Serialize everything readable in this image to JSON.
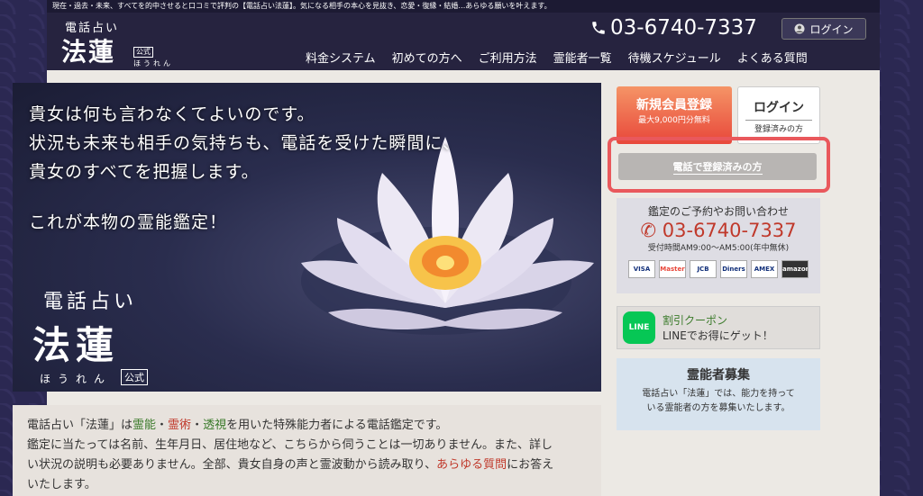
{
  "topbar": {
    "text": "現在・過去・未来、すべてを的中させると口コミで評判の【電話占い法蓮】。気になる相手の本心を見抜き、恋愛・復縁・結婚…あらゆる願いを叶えます。"
  },
  "header": {
    "logo_small": "電話占い",
    "logo_big": "法蓮",
    "logo_badge": "公式",
    "logo_kana": "ほうれん",
    "phone": "03-6740-7337",
    "login": "ログイン"
  },
  "nav": {
    "items": [
      "料金システム",
      "初めての方へ",
      "ご利用方法",
      "霊能者一覧",
      "待機スケジュール",
      "よくある質問"
    ]
  },
  "hero": {
    "line1": "貴女は何も言わなくてよいのです。",
    "line2": "状況も未来も相手の気持ちも、電話を受けた瞬間に、",
    "line3": "貴女のすべてを把握します。",
    "line4": "これが本物の霊能鑑定！",
    "brand_small": "電話占い",
    "brand_big": "法蓮",
    "kana": "ほうれん",
    "badge": "公式"
  },
  "intro": {
    "p1a": "電話占い「法蓮」は",
    "p1b": "霊能",
    "p1c": "・",
    "p1d": "霊術",
    "p1e": "・",
    "p1f": "透視",
    "p1g": "を用いた特殊能力者による電話鑑定です。",
    "p2": "鑑定に当たっては名前、生年月日、居住地など、こちらから伺うことは一切ありません。また、詳し",
    "p3a": "い状況の説明も必要ありません。全部、貴女自身の声と霊波動から読み取り、",
    "p3b": "あらゆる質問",
    "p3c": "にお答え",
    "p4": "いたします。"
  },
  "sidebar": {
    "register_title": "新規会員登録",
    "register_sub": "最大9,000円分無料",
    "login_title": "ログイン",
    "login_sub": "登録済みの方",
    "tel_registered": "電話で登録済みの方",
    "contact_title": "鑑定のご予約やお問い合わせ",
    "contact_phone": "03-6740-7337",
    "contact_hours": "受付時間AM9:00〜AM5:00(年中無休)",
    "cards": [
      "VISA",
      "Master",
      "JCB",
      "Diners",
      "AMEX",
      "amazon pay"
    ],
    "line_title": "割引クーポン",
    "line_text": "LINEでお得にゲット！",
    "line_icon": "LINE",
    "recruit_title": "霊能者募集",
    "recruit_text1": "電話占い「法蓮」では、能力を持って",
    "recruit_text2": "いる霊能者の方を募集いたします。"
  },
  "colors": {
    "header": "#26233f",
    "accent_red": "#c0392b",
    "register": "#e8473a",
    "highlight": "#e9585c",
    "line": "#06c755"
  }
}
